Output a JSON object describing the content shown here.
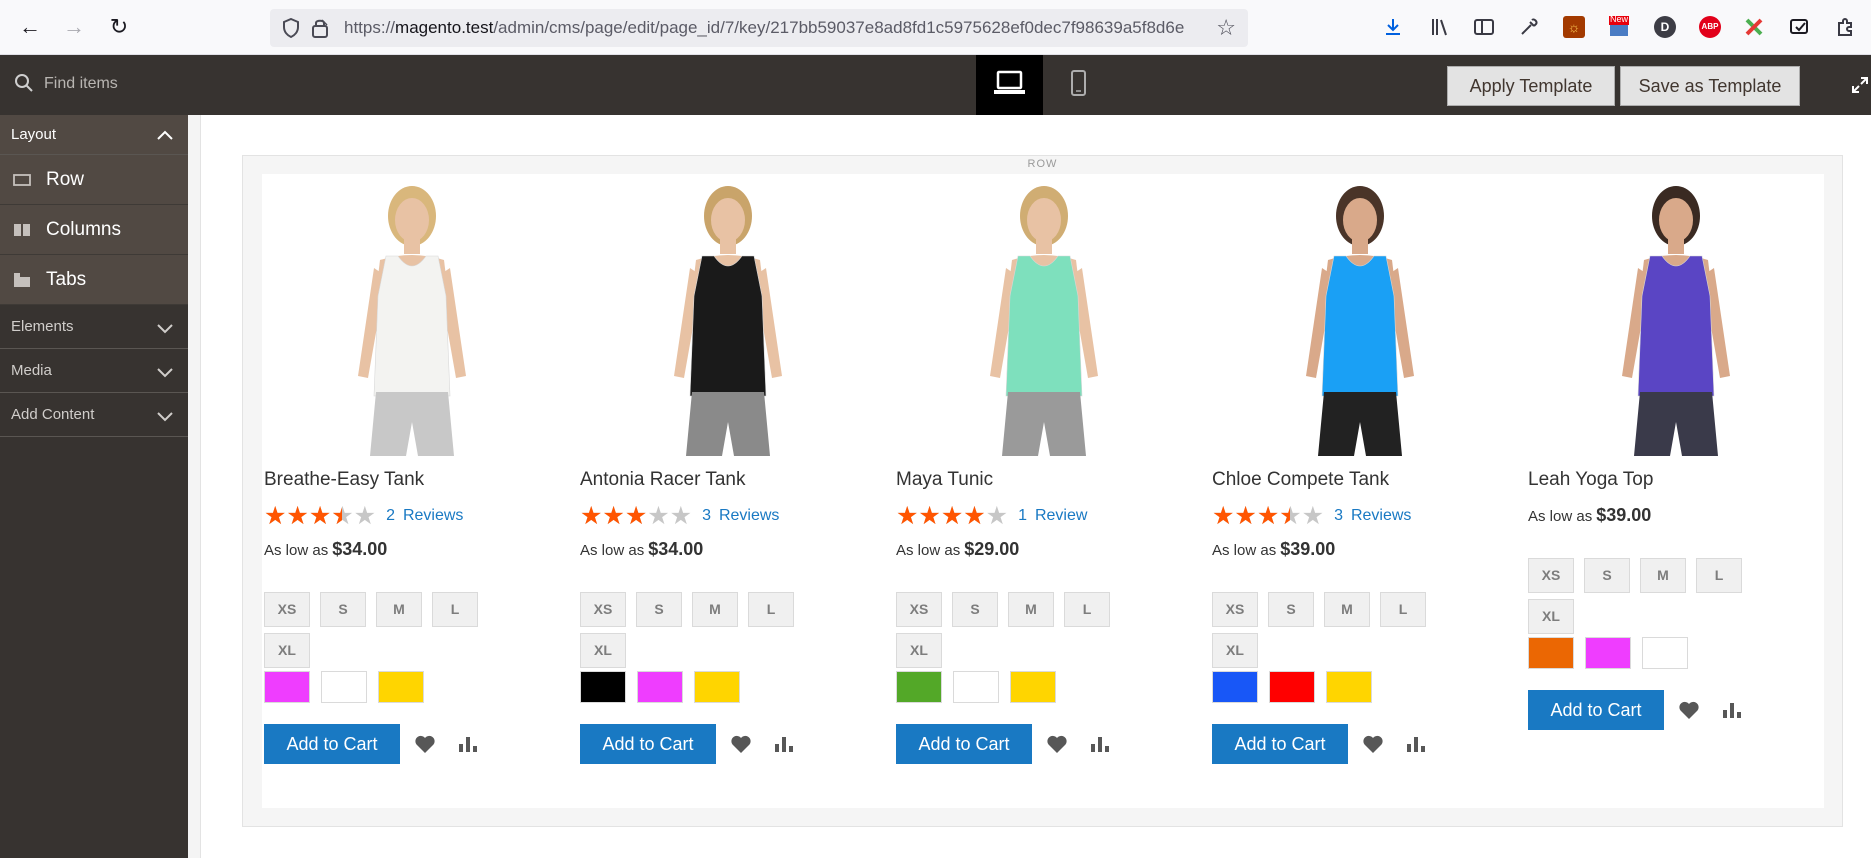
{
  "browser": {
    "url_prefix": "https://",
    "url_host": "magento.test",
    "url_path": "/admin/cms/page/edit/page_id/7/key/217bb59037e8ad8fd1c5975628ef0dec7f98639a5f8d6e",
    "badge_new": "New",
    "badge_abp": "ABP",
    "badge_d": "D"
  },
  "header": {
    "search_placeholder": "Find items",
    "apply_template": "Apply Template",
    "save_template": "Save as Template"
  },
  "sidebar": {
    "layout_label": "Layout",
    "layout_items": [
      {
        "label": "Row",
        "icon": "row-icon"
      },
      {
        "label": "Columns",
        "icon": "columns-icon"
      },
      {
        "label": "Tabs",
        "icon": "tabs-icon"
      }
    ],
    "sections": [
      {
        "label": "Elements"
      },
      {
        "label": "Media"
      },
      {
        "label": "Add Content"
      }
    ]
  },
  "row_label": "ROW",
  "colors": {
    "accent_blue": "#1979c3",
    "star_orange": "#ff5501",
    "admin_dark": "#373330"
  },
  "products": [
    {
      "name": "Breathe-Easy Tank",
      "rating": 0.7,
      "reviews_count": "2",
      "reviews_text": "Reviews",
      "price_prefix": "As low as",
      "price": "$34.00",
      "sizes": [
        "XS",
        "S",
        "M",
        "L",
        "XL"
      ],
      "swatches": [
        "#ef3dff",
        "#ffffff",
        "#ffd500"
      ],
      "shirt_color": "#f3f3f1",
      "shorts_color": "#c8c8c8",
      "skin": "#e8c2a4",
      "hair": "#d9b77c",
      "add_to_cart": "Add to Cart"
    },
    {
      "name": "Antonia Racer Tank",
      "rating": 0.6,
      "reviews_count": "3",
      "reviews_text": "Reviews",
      "price_prefix": "As low as",
      "price": "$34.00",
      "sizes": [
        "XS",
        "S",
        "M",
        "L",
        "XL"
      ],
      "swatches": [
        "#000000",
        "#ef3dff",
        "#ffd500"
      ],
      "shirt_color": "#1a1a1a",
      "shorts_color": "#8a8a8a",
      "skin": "#e8c2a4",
      "hair": "#c9a46a",
      "add_to_cart": "Add to Cart"
    },
    {
      "name": "Maya Tunic",
      "rating": 0.8,
      "reviews_count": "1",
      "reviews_text": "Review",
      "price_prefix": "As low as",
      "price": "$29.00",
      "sizes": [
        "XS",
        "S",
        "M",
        "L",
        "XL"
      ],
      "swatches": [
        "#53a828",
        "#ffffff",
        "#ffd500"
      ],
      "shirt_color": "#7ee0bd",
      "shorts_color": "#9a9a9a",
      "skin": "#e8c2a4",
      "hair": "#d0ad73",
      "add_to_cart": "Add to Cart"
    },
    {
      "name": "Chloe Compete Tank",
      "rating": 0.7,
      "reviews_count": "3",
      "reviews_text": "Reviews",
      "price_prefix": "As low as",
      "price": "$39.00",
      "sizes": [
        "XS",
        "S",
        "M",
        "L",
        "XL"
      ],
      "swatches": [
        "#1857f7",
        "#ff0000",
        "#ffd500"
      ],
      "shirt_color": "#1aa0f5",
      "shorts_color": "#222222",
      "skin": "#d9a98a",
      "hair": "#4a3428",
      "add_to_cart": "Add to Cart"
    },
    {
      "name": "Leah Yoga Top",
      "rating": null,
      "reviews_count": "",
      "reviews_text": "",
      "price_prefix": "As low as",
      "price": "$39.00",
      "sizes": [
        "XS",
        "S",
        "M",
        "L",
        "XL"
      ],
      "swatches": [
        "#eb6703",
        "#ef3dff",
        "#ffffff"
      ],
      "shirt_color": "#5a45c4",
      "shorts_color": "#3a3a4a",
      "skin": "#d9a98a",
      "hair": "#3a2a22",
      "add_to_cart": "Add to Cart"
    }
  ]
}
